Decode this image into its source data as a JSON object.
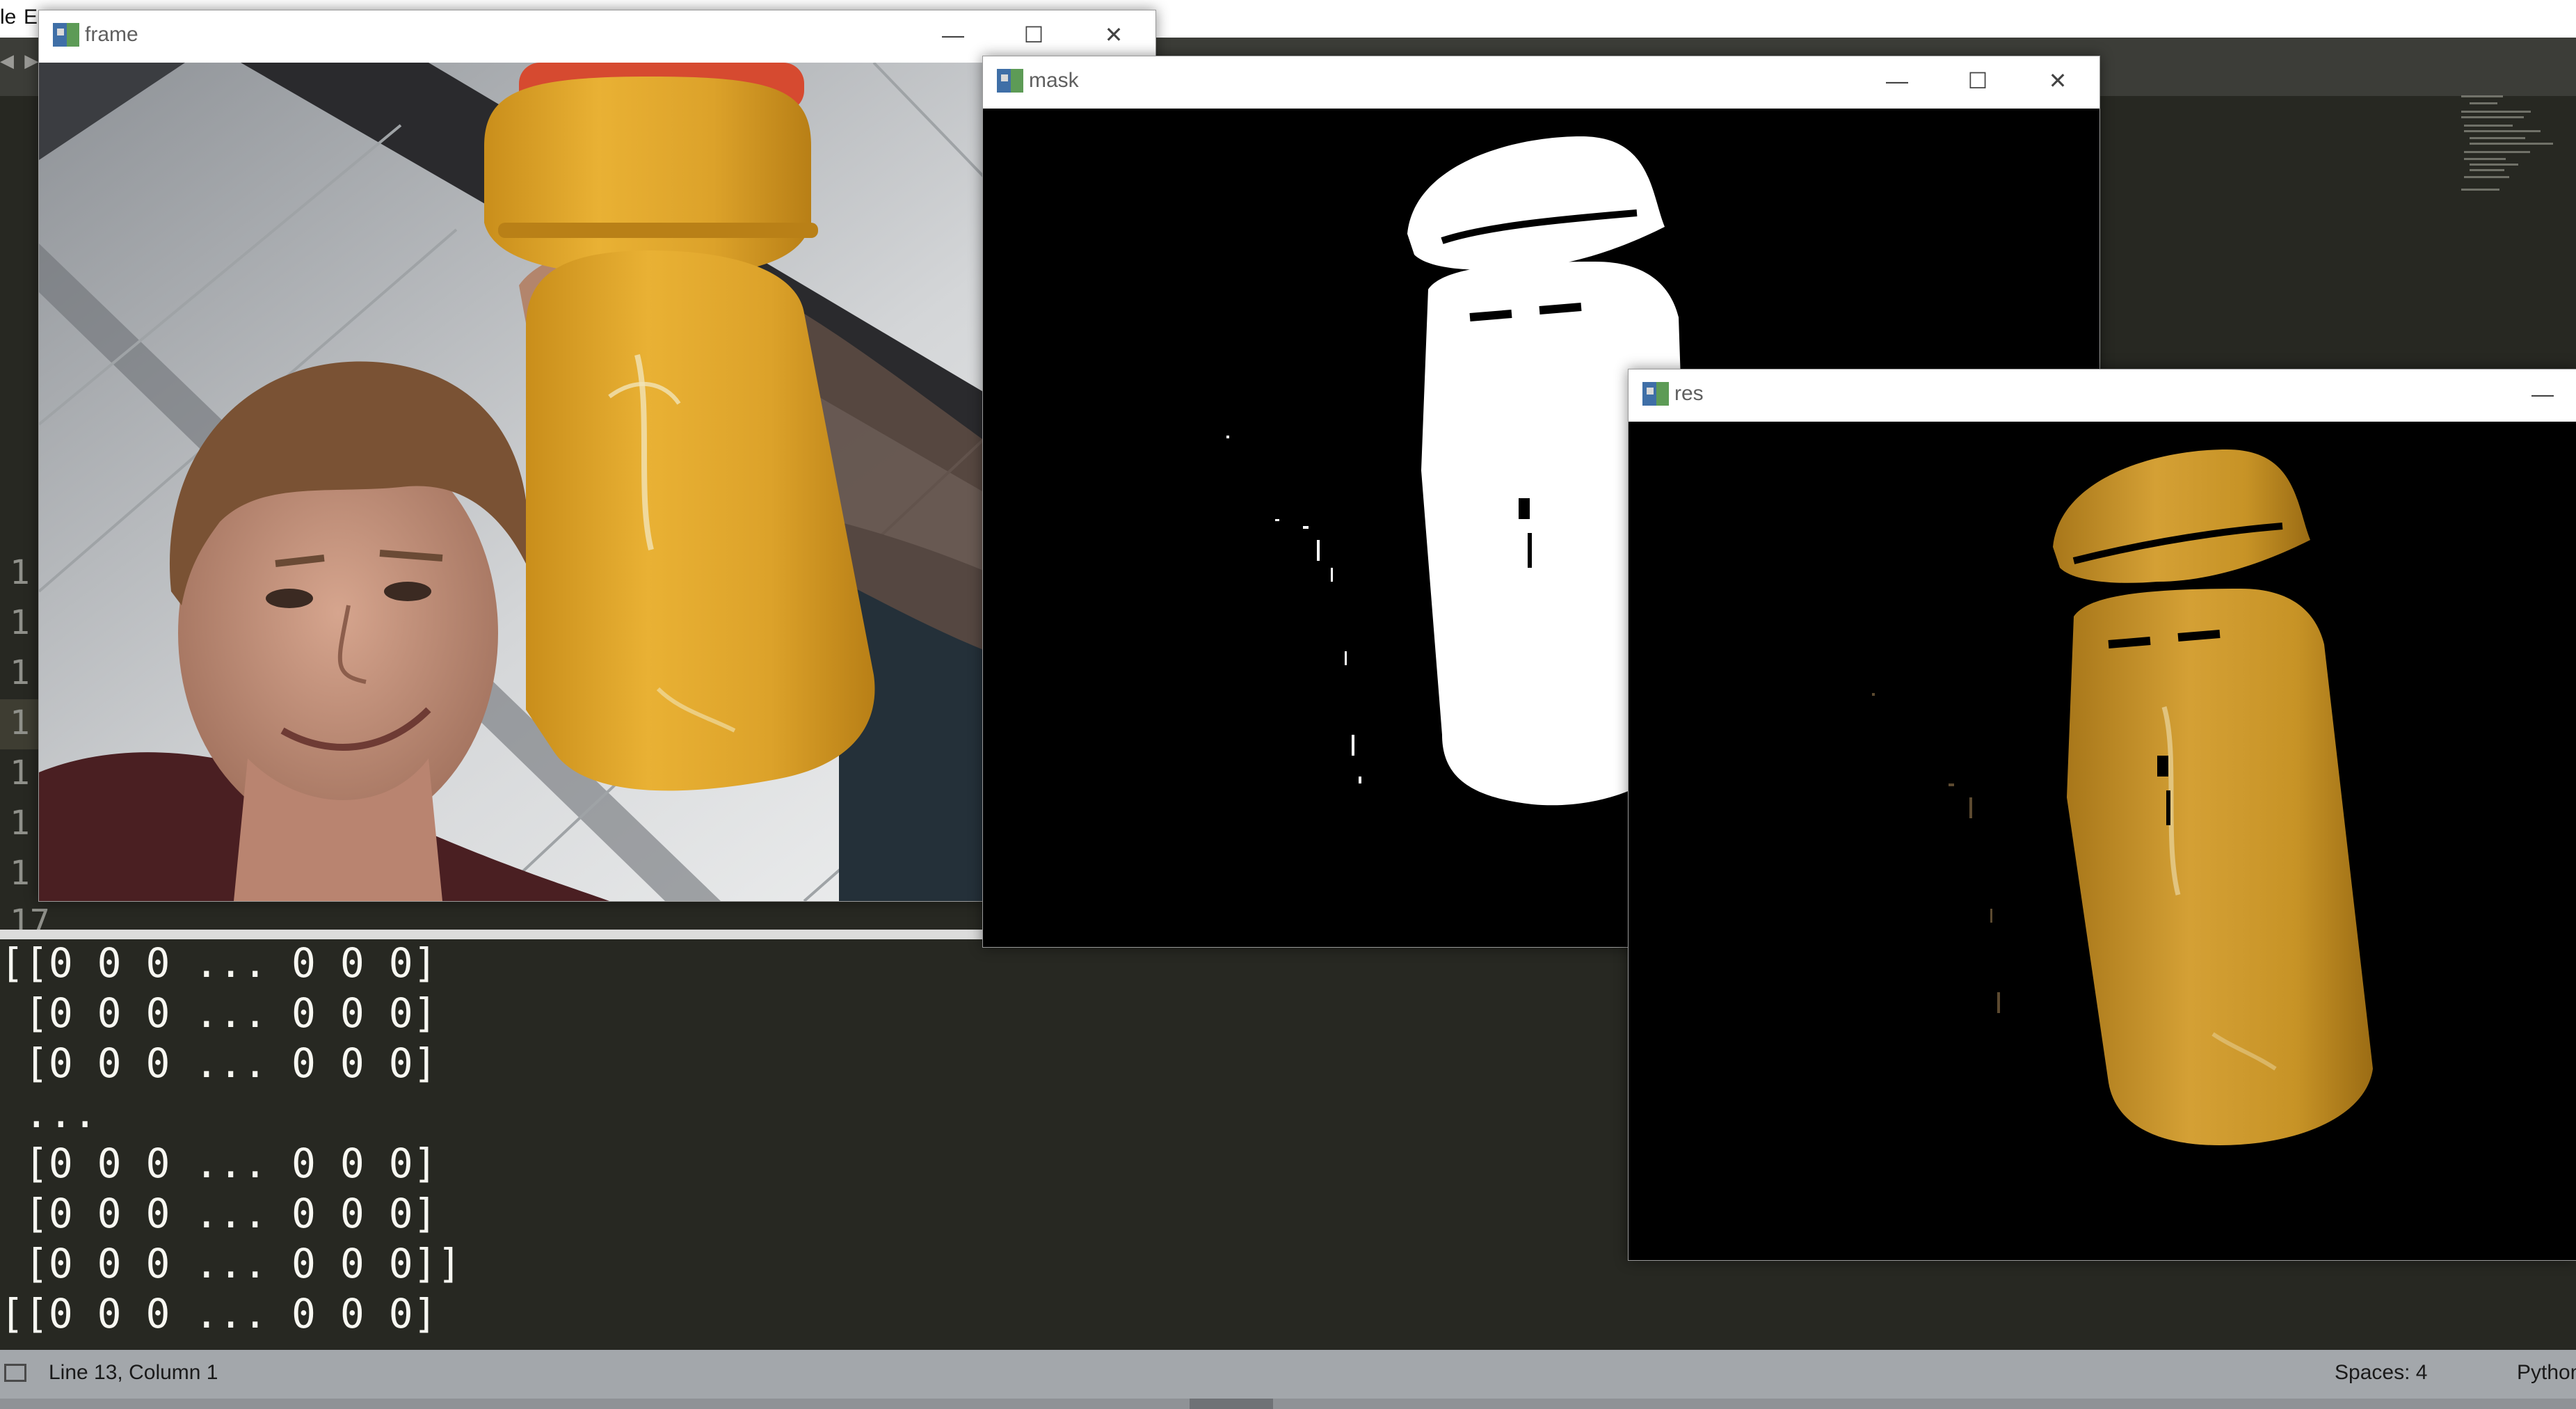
{
  "menubar": {
    "file_fragment": "le",
    "edit_fragment": "E"
  },
  "tab_nav_glyph": "◀ ▶",
  "gutter": {
    "numbers": [
      "1",
      "1",
      "1",
      "1",
      "1",
      "1",
      "1",
      "17"
    ]
  },
  "console": {
    "lines": [
      "[[0 0 0 ... 0 0 0]",
      " [0 0 0 ... 0 0 0]",
      " [0 0 0 ... 0 0 0]",
      " ...",
      " [0 0 0 ... 0 0 0]",
      " [0 0 0 ... 0 0 0]",
      " [0 0 0 ... 0 0 0]]",
      "[[0 0 0 ... 0 0 0]"
    ]
  },
  "statusbar": {
    "position": "Line 13, Column 1",
    "indent": "Spaces: 4",
    "syntax": "Python"
  },
  "windows": {
    "frame": {
      "title": "frame",
      "minimize": "—",
      "maximize": "☐",
      "close": "✕"
    },
    "mask": {
      "title": "mask",
      "minimize": "—",
      "maximize": "☐",
      "close": "✕"
    },
    "res": {
      "title": "res",
      "minimize": "—"
    }
  },
  "colors": {
    "editor_bg": "#272822",
    "statusbar_bg": "#a3a7ab",
    "bottle_orange": "#e0a52a",
    "res_bottle": "#c79326"
  }
}
